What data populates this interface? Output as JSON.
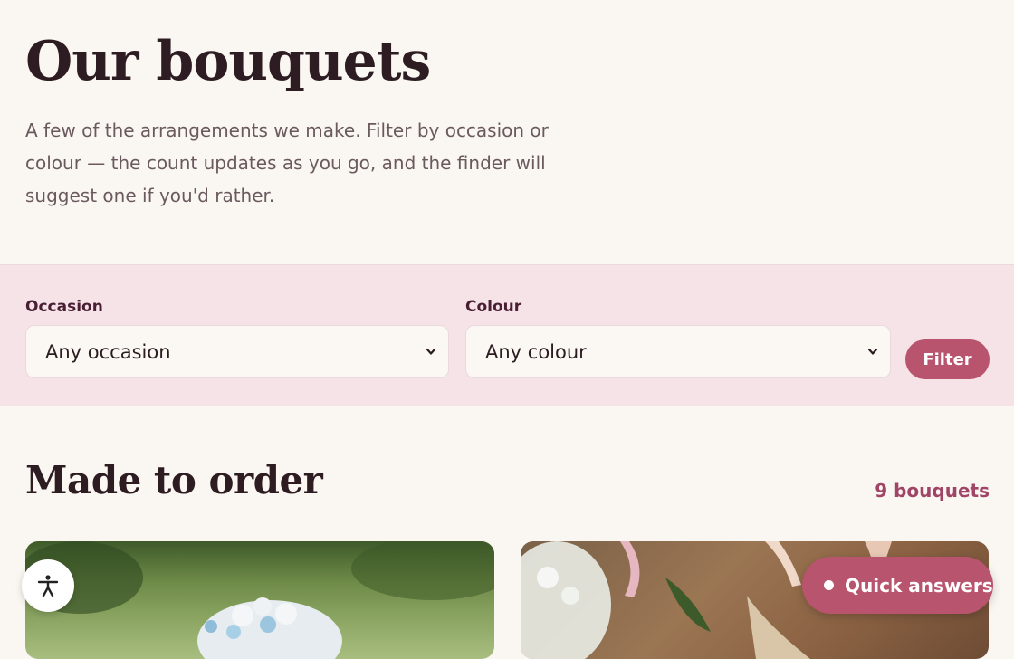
{
  "hero": {
    "title": "Our bouquets",
    "intro": "A few of the arrangements we make. Filter by occasion or colour — the count updates as you go, and the finder will suggest one if you'd rather."
  },
  "filters": {
    "occasion": {
      "label": "Occasion",
      "selected": "Any occasion"
    },
    "colour": {
      "label": "Colour",
      "selected": "Any colour"
    },
    "submit_label": "Filter"
  },
  "catalogue": {
    "title": "Made to order",
    "count_text": "9 bouquets"
  },
  "floating": {
    "quick_answers_label": "Quick answers"
  },
  "colors": {
    "accent": "#b8546d",
    "filter_bar": "#f5e3e8",
    "background": "#faf6f2"
  }
}
